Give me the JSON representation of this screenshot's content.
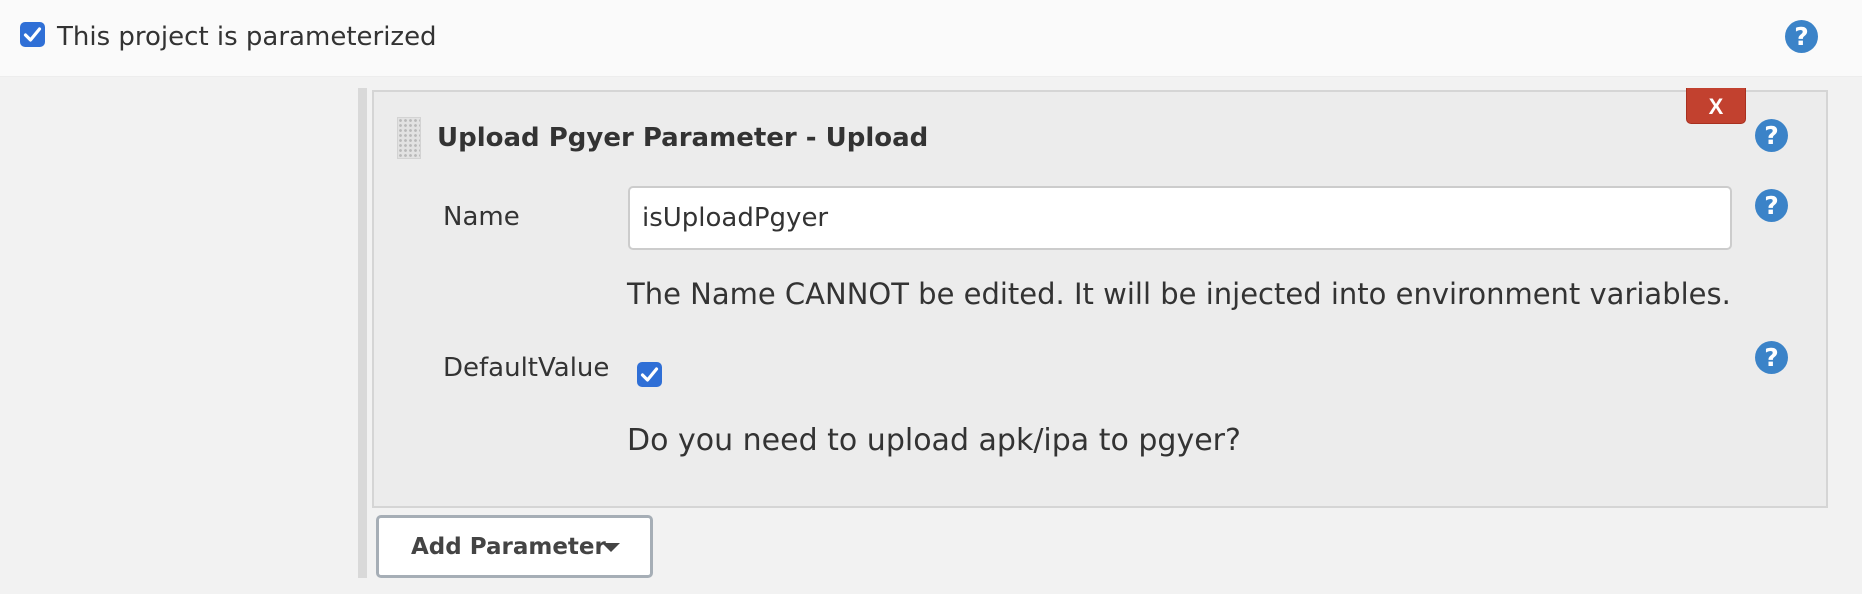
{
  "parameterized": {
    "checked": true,
    "label": "This project is parameterized",
    "help_icon": "question-mark-icon"
  },
  "parameter": {
    "title": "Upload Pgyer Parameter - Upload",
    "delete_label": "X",
    "grip_icon": "drag-handle-icon",
    "name_label": "Name",
    "name_value": "isUploadPgyer",
    "name_description": "The Name CANNOT be edited. It will be injected into environment variables.",
    "default_label": "DefaultValue",
    "default_checked": true,
    "default_description": "Do you need to upload apk/ipa to pgyer?",
    "help_icon_glyph": "?"
  },
  "add_parameter": {
    "label": "Add Parameter",
    "icon": "caret-down-icon"
  },
  "colors": {
    "help_blue": "#3b83c8",
    "checkbox_blue": "#2f6fd6",
    "delete_red": "#c2412f"
  }
}
